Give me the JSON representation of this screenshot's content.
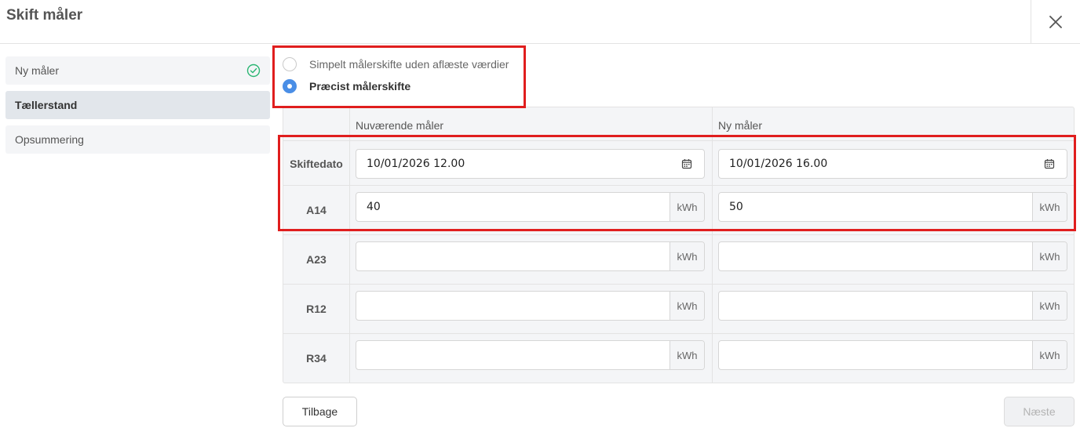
{
  "dialog": {
    "title": "Skift måler"
  },
  "steps": [
    {
      "label": "Ny måler",
      "completed": true
    },
    {
      "label": "Tællerstand",
      "active": true
    },
    {
      "label": "Opsummering"
    }
  ],
  "mode": {
    "options": [
      {
        "label": "Simpelt målerskifte uden aflæste værdier",
        "selected": false
      },
      {
        "label": "Præcist målerskifte",
        "selected": true
      }
    ]
  },
  "table": {
    "columns": [
      "Nuværende måler",
      "Ny måler"
    ],
    "rows": [
      {
        "label": "Skiftedato",
        "current": "10/01/2026 12.00",
        "new": "10/01/2026 16.00"
      },
      {
        "label": "A14",
        "current": "40",
        "new": "50",
        "unit": "kWh"
      },
      {
        "label": "A23",
        "current": "",
        "new": "",
        "unit": "kWh"
      },
      {
        "label": "R12",
        "current": "",
        "new": "",
        "unit": "kWh"
      },
      {
        "label": "R34",
        "current": "",
        "new": "",
        "unit": "kWh"
      }
    ]
  },
  "buttons": {
    "back": "Tilbage",
    "next": "Næste"
  },
  "colors": {
    "accent": "#4a8ee6",
    "highlight": "#e01e1e",
    "success": "#2bb673"
  }
}
